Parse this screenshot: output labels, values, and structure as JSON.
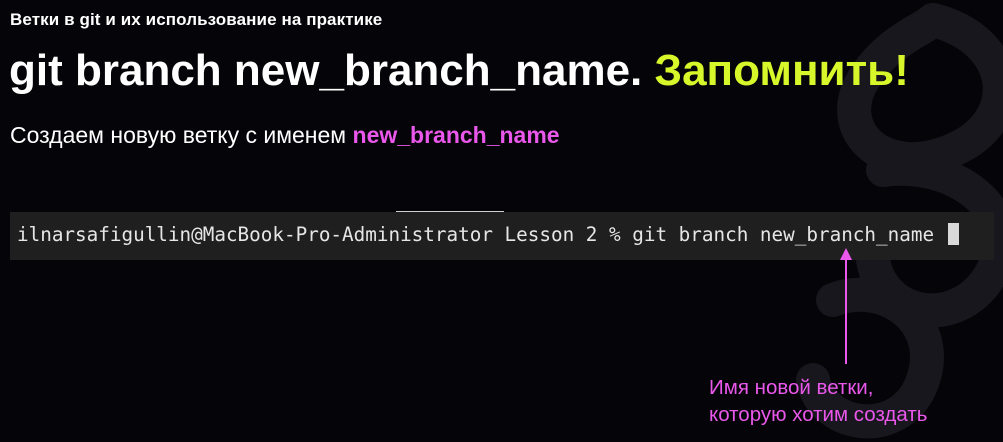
{
  "slide": {
    "topic": "Ветки в git и их использование на практике",
    "headline": "git branch new_branch_name.",
    "headline_accent": "Запомнить!",
    "subline_prefix": "Создаем новую ветку с именем",
    "subline_highlight": "new_branch_name"
  },
  "terminal": {
    "line": "ilnarsafigullin@MacBook-Pro-Administrator Lesson 2 % git branch new_branch_name"
  },
  "annotation": {
    "line1": "Имя новой ветки,",
    "line2": "которую хотим создать"
  },
  "colors": {
    "background": "#050509",
    "accent_yellow": "#d7f72a",
    "accent_pink": "#ea57eb",
    "terminal_bg": "#1f1f1f"
  },
  "icons": {
    "annotation_arrow": "arrow-up-icon",
    "background_decoration": "chain-link-decoration"
  }
}
